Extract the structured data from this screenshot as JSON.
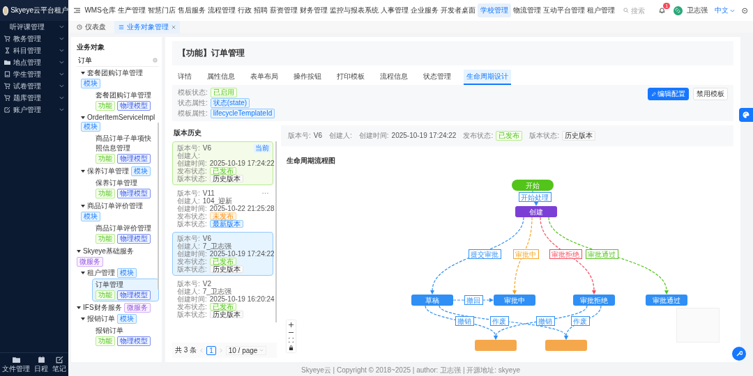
{
  "sidebar": {
    "brand": "Skyeye云平台租户",
    "section": "听评课管理",
    "items": [
      {
        "label": "教务管理"
      },
      {
        "label": "科目管理"
      },
      {
        "label": "地点管理"
      },
      {
        "label": "学生管理"
      },
      {
        "label": "试卷管理"
      },
      {
        "label": "题库管理"
      },
      {
        "label": "账户管理"
      }
    ],
    "tools": [
      "文件管理",
      "日程",
      "笔记"
    ]
  },
  "header": {
    "nav": [
      {
        "label": "WMS仓库",
        "selected": false
      },
      {
        "label": "生产管理",
        "selected": false
      },
      {
        "label": "智慧门店",
        "selected": false
      },
      {
        "label": "售后服务",
        "selected": false
      },
      {
        "label": "流程管理",
        "selected": false
      },
      {
        "label": "行政",
        "selected": false
      },
      {
        "label": "招聘",
        "selected": false
      },
      {
        "label": "薪资管理",
        "selected": false
      },
      {
        "label": "财务管理",
        "selected": false
      },
      {
        "label": "监控与报表系统",
        "selected": false
      },
      {
        "label": "人事管理",
        "selected": false
      },
      {
        "label": "企业服务",
        "selected": false
      },
      {
        "label": "开发者桌面",
        "selected": false
      },
      {
        "label": "学校管理",
        "selected": true
      },
      {
        "label": "物流管理",
        "selected": false
      },
      {
        "label": "互动平台管理",
        "selected": false
      },
      {
        "label": "租户管理",
        "selected": false
      }
    ],
    "search": {
      "placeholder": "搜索"
    },
    "notifications": "1",
    "user": "卫志强",
    "language": "中文"
  },
  "page_tabs": [
    {
      "label": "仪表盘",
      "selected": false,
      "closable": false
    },
    {
      "label": "业务对象管理",
      "selected": true,
      "closable": true
    }
  ],
  "objects": {
    "title": "业务对象",
    "search": {
      "value": "订单"
    },
    "tree": [
      {
        "children": [
          {
            "label": "套餐团购订单管理",
            "tag": {
              "text": "模块",
              "kind": "module"
            },
            "expanded": true,
            "children": [
              {
                "label": "套餐团购订单管理",
                "tags": [
                  {
                    "text": "功能",
                    "kind": "function"
                  },
                  {
                    "text": "物理模型",
                    "kind": "model"
                  }
                ],
                "selected": false
              }
            ]
          },
          {
            "label": "OrderItemServiceImpl",
            "tag": {
              "text": "模块",
              "kind": "module"
            },
            "expanded": true,
            "children": [
              {
                "label": "商品订单子单项快照信息管理",
                "tags": [
                  {
                    "text": "功能",
                    "kind": "function"
                  },
                  {
                    "text": "物理模型",
                    "kind": "model"
                  }
                ],
                "selected": false
              }
            ]
          },
          {
            "label": "保养订单管理",
            "tag": {
              "text": "模块",
              "kind": "module"
            },
            "expanded": true,
            "children": [
              {
                "label": "保养订单管理",
                "tags": [
                  {
                    "text": "功能",
                    "kind": "function"
                  },
                  {
                    "text": "物理模型",
                    "kind": "model"
                  }
                ],
                "selected": false
              }
            ]
          },
          {
            "label": "商品订单评价管理",
            "tag": {
              "text": "模块",
              "kind": "module"
            },
            "expanded": true,
            "children": [
              {
                "label": "商品订单评价管理",
                "tags": [
                  {
                    "text": "功能",
                    "kind": "function"
                  },
                  {
                    "text": "物理模型",
                    "kind": "model"
                  }
                ],
                "selected": false
              }
            ]
          }
        ]
      },
      {
        "label": "Skyeye基础服务",
        "tag": {
          "text": "微服务",
          "kind": "microservice"
        },
        "expanded": true,
        "children": [
          {
            "label": "租户管理",
            "tag": {
              "text": "模块",
              "kind": "module"
            },
            "expanded": true,
            "children": [
              {
                "label": "订单管理",
                "tags": [
                  {
                    "text": "功能",
                    "kind": "function"
                  },
                  {
                    "text": "物理模型",
                    "kind": "model"
                  }
                ],
                "selected": true
              }
            ]
          }
        ]
      },
      {
        "label": "IFS财务服务",
        "tag": {
          "text": "微服务",
          "kind": "microservice"
        },
        "expanded": true,
        "children": [
          {
            "label": "报销订单",
            "tag": {
              "text": "模块",
              "kind": "module"
            },
            "expanded": true,
            "children": [
              {
                "label": "报销订单",
                "tags": [
                  {
                    "text": "功能",
                    "kind": "function"
                  },
                  {
                    "text": "物理模型",
                    "kind": "model"
                  }
                ],
                "selected": false
              }
            ]
          }
        ]
      }
    ]
  },
  "detail": {
    "title": "【功能】订单管理",
    "tabs": [
      {
        "label": "详情",
        "selected": false
      },
      {
        "label": "属性信息",
        "selected": false
      },
      {
        "label": "表单布局",
        "selected": false
      },
      {
        "label": "操作按钮",
        "selected": false
      },
      {
        "label": "打印模板",
        "selected": false
      },
      {
        "label": "流程信息",
        "selected": false
      },
      {
        "label": "状态管理",
        "selected": false
      },
      {
        "label": "生命周期设计",
        "selected": true
      }
    ],
    "info": [
      {
        "label": "模板状态:",
        "value": "已启用",
        "kind": "success"
      },
      {
        "label": "状态属性:",
        "value": "状态(state)",
        "kind": "primary"
      },
      {
        "label": "模板属性:",
        "value": "lifecycleTemplateId",
        "kind": "primary"
      }
    ],
    "buttons": [
      {
        "label": "编辑配置",
        "kind": "primary"
      },
      {
        "label": "禁用模板",
        "kind": "default"
      }
    ],
    "versions": {
      "title": "版本历史",
      "cards": [
        {
          "current": true,
          "selected": false,
          "badge": "当前",
          "menu": false,
          "rows": [
            {
              "label": "版本号:",
              "value": "V6",
              "kind": "text"
            },
            {
              "label": "创建人:",
              "kind": "text"
            },
            {
              "label": "创建时间:",
              "value": "2025-10-19 17:24:22",
              "kind": "text"
            },
            {
              "label": "发布状态:",
              "value": "已发布",
              "kind": "success"
            },
            {
              "label": "版本状态:",
              "value": "历史版本",
              "kind": "default"
            }
          ]
        },
        {
          "current": false,
          "selected": false,
          "menu": true,
          "rows": [
            {
              "label": "版本号:",
              "value": "V11",
              "kind": "text"
            },
            {
              "label": "创建人:",
              "value": "104_迎新",
              "kind": "text"
            },
            {
              "label": "创建时间:",
              "value": "2025-10-22 21:25:28",
              "kind": "text"
            },
            {
              "label": "发布状态:",
              "value": "未发布",
              "kind": "warning"
            },
            {
              "label": "版本状态:",
              "value": "最新版本",
              "kind": "primary"
            }
          ]
        },
        {
          "current": false,
          "selected": true,
          "menu": false,
          "rows": [
            {
              "label": "版本号:",
              "value": "V6",
              "kind": "text"
            },
            {
              "label": "创建人:",
              "value": "7_卫志强",
              "kind": "text"
            },
            {
              "label": "创建时间:",
              "value": "2025-10-19 17:24:22",
              "kind": "text"
            },
            {
              "label": "发布状态:",
              "value": "已发布",
              "kind": "success"
            },
            {
              "label": "版本状态:",
              "value": "历史版本",
              "kind": "default"
            }
          ]
        },
        {
          "current": false,
          "selected": false,
          "menu": false,
          "rows": [
            {
              "label": "版本号:",
              "value": "V2",
              "kind": "text"
            },
            {
              "label": "创建人:",
              "value": "7_卫志强",
              "kind": "text"
            },
            {
              "label": "创建时间:",
              "value": "2025-10-19 16:20:24",
              "kind": "text"
            },
            {
              "label": "发布状态:",
              "value": "已发布",
              "kind": "success"
            },
            {
              "label": "版本状态:",
              "value": "历史版本",
              "kind": "default"
            }
          ]
        }
      ],
      "pager": {
        "total": "共 3 条",
        "pages": [
          {
            "label": "1",
            "selected": true
          }
        ],
        "page_size": "10 / page"
      }
    },
    "version_bar": [
      {
        "label": "版本号:",
        "value": "V6",
        "kind": "text"
      },
      {
        "label": "创建人:",
        "kind": "text"
      },
      {
        "label": "创建时间:",
        "value": "2025-10-19 17:24:22",
        "kind": "text"
      },
      {
        "label": "发布状态:",
        "value": "已发布",
        "kind": "success"
      },
      {
        "label": "版本状态:",
        "value": "历史版本",
        "kind": "default"
      }
    ],
    "flow": {
      "title": "生命周期流程图",
      "nodes": [
        {
          "label": "开始",
          "kind": "start",
          "color": "#52c41a"
        },
        {
          "label": "创建",
          "kind": "state",
          "color": "#7b3fd6"
        },
        {
          "label": "草稿",
          "kind": "state",
          "color": "#2f8ff5"
        },
        {
          "label": "审批中",
          "kind": "state",
          "color": "#2f8ff5"
        },
        {
          "label": "审批拒绝",
          "kind": "state",
          "color": "#2f8ff5"
        },
        {
          "label": "审批通过",
          "kind": "state",
          "color": "#2f8ff5"
        },
        {
          "kind": "state",
          "color": "#f5a84b"
        },
        {
          "kind": "state",
          "color": "#f5a84b"
        }
      ],
      "edges": [
        {
          "label": "开始处理",
          "color": "#2f8ff5"
        },
        {
          "label": "提交审批",
          "color": "#2f8ff5"
        },
        {
          "label": "审批中",
          "color": "#f5a623"
        },
        {
          "label": "审批拒绝",
          "color": "#f5485b"
        },
        {
          "label": "审批通过",
          "color": "#52c41a"
        },
        {
          "label": "撤回",
          "color": "#2f8ff5"
        },
        {
          "label": "撤销",
          "color": "#2f8ff5"
        },
        {
          "label": "作废",
          "color": "#2f8ff5"
        },
        {
          "label": "撤销",
          "color": "#2f8ff5"
        },
        {
          "label": "作废",
          "color": "#2f8ff5"
        }
      ]
    }
  },
  "footer": "Skyeye云 | Copyright © 2018~2025 | author: 卫志强 | 开源地址: skyeye"
}
